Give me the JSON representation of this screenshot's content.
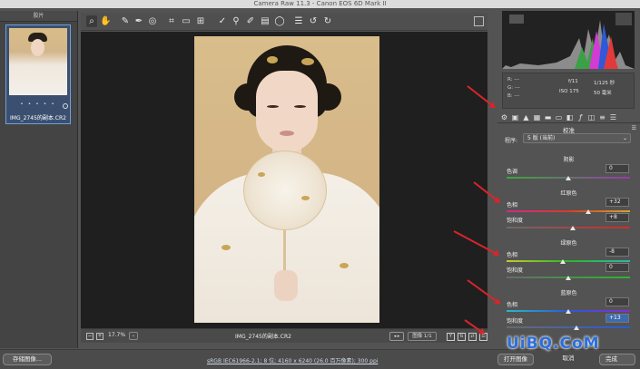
{
  "window": {
    "title": "Camera Raw 11.3  -  Canon EOS 6D Mark II"
  },
  "filmstrip": {
    "header": "胶片",
    "filename": "IMG_2745的副本.CR2",
    "rating": "• • • • •"
  },
  "toolbar": {
    "tools": [
      "zoom-tool",
      "hand-tool",
      "white-balance-tool",
      "color-sampler-tool",
      "targeted-adjustment-tool",
      "crop-tool",
      "straighten-tool",
      "transform-tool",
      "spot-removal-tool",
      "red-eye-tool",
      "adjustment-brush-tool",
      "graduated-filter-tool",
      "radial-filter-tool",
      "preferences-icon",
      "rotate-left-icon",
      "rotate-right-icon"
    ]
  },
  "status": {
    "zoom": "17.7%",
    "filename": "IMG_2745的副本.CR2",
    "image_count": "图像 1/1"
  },
  "camera": {
    "r": "R:  ---",
    "g": "G:  ---",
    "b": "B:  ---",
    "aperture": "f/11",
    "shutter": "1/125 秒",
    "iso": "ISO 175",
    "focal": "50 毫米"
  },
  "panel": {
    "title": "校准",
    "profile_label": "程序:",
    "profile_value": "5 版 (当前)",
    "shadows_title": "阴影",
    "shadows_tint_label": "色调",
    "shadows_tint_value": "0",
    "red_title": "红原色",
    "red_hue_label": "色相",
    "red_hue_value": "+32",
    "red_sat_label": "饱和度",
    "red_sat_value": "+8",
    "green_title": "绿原色",
    "green_hue_label": "色相",
    "green_hue_value": "-8",
    "green_sat_label": "饱和度",
    "green_sat_value": "0",
    "blue_title": "蓝原色",
    "blue_hue_label": "色相",
    "blue_hue_value": "0",
    "blue_sat_label": "饱和度",
    "blue_sat_value": "+13"
  },
  "bottom": {
    "save": "存储图像...",
    "workflow": "sRGB IEC61966-2.1; 8 位; 4160 x 6240 (26.0 百万像素); 300 ppi",
    "open": "打开图像",
    "cancel": "取消",
    "done": "完成"
  },
  "watermark": "UiBQ.CoM",
  "colors": {
    "accent": "#3d6bb0",
    "annotation": "#d9252a",
    "watermark": "#2c6fdc"
  }
}
